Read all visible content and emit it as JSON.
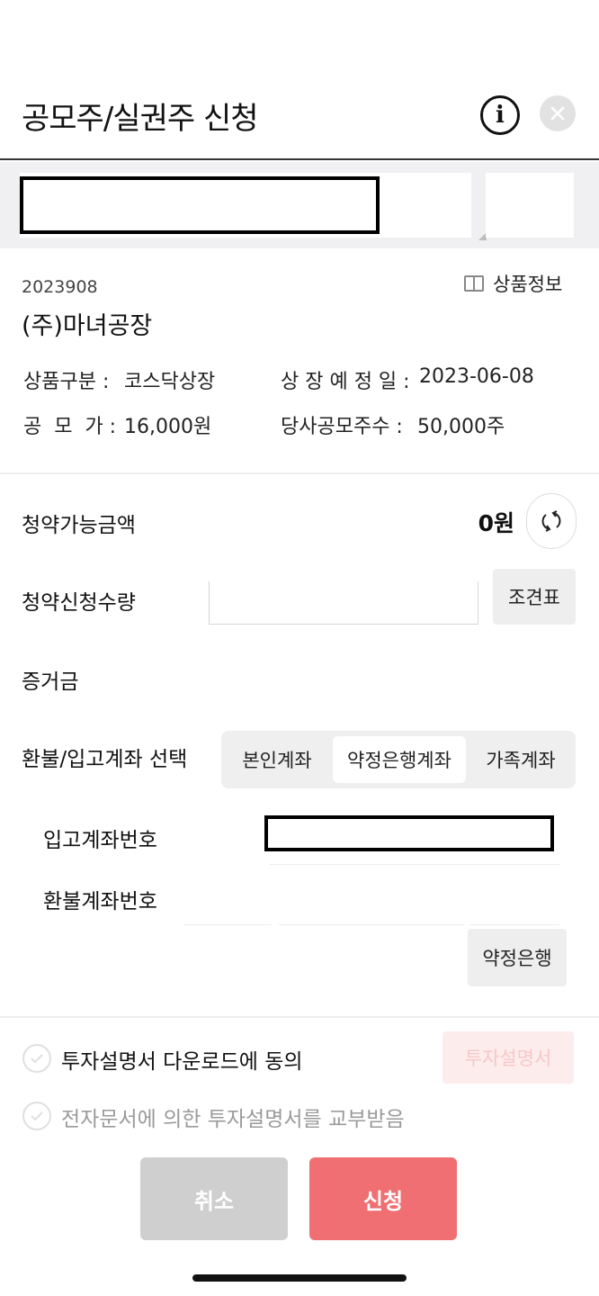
{
  "header": {
    "title": "공모주/실권주 신청",
    "info_icon": "info-icon",
    "close_icon": "close-icon"
  },
  "product": {
    "code": "2023908",
    "info_link": "상품정보",
    "company": "(주)마녀공장",
    "fields": [
      {
        "label": "상품구분 :",
        "value": "코스닥상장"
      },
      {
        "label": "상 장 예 정 일 :",
        "value": "2023-06-08"
      },
      {
        "label": "공  모  가 :",
        "value": "16,000원"
      },
      {
        "label": "당사공모주수 :",
        "value": "50,000주"
      }
    ]
  },
  "form": {
    "available_label": "청약가능금액",
    "available_amount": "0원",
    "qty_label": "청약신청수량",
    "qty_value": "",
    "table_button": "조견표",
    "deposit_label": "증거금",
    "account_label": "환불/입고계좌 선택",
    "account_options": [
      "본인계좌",
      "약정은행계좌",
      "가족계좌"
    ],
    "selected_account_option": "약정은행계좌",
    "in_account_label": "입고계좌번호",
    "refund_account_label": "환불계좌번호",
    "bank_button": "약정은행"
  },
  "agreements": [
    {
      "text": "투자설명서 다운로드에 동의",
      "checked": false
    },
    {
      "text": "전자문서에 의한 투자설명서를 교부받음",
      "checked": false
    }
  ],
  "prospectus_button": "투자설명서",
  "actions": {
    "cancel": "취소",
    "apply": "신청"
  },
  "colors": {
    "accent": "#ef6f73",
    "disabled": "#cfcfcf",
    "accent_light": "#fdecec"
  }
}
